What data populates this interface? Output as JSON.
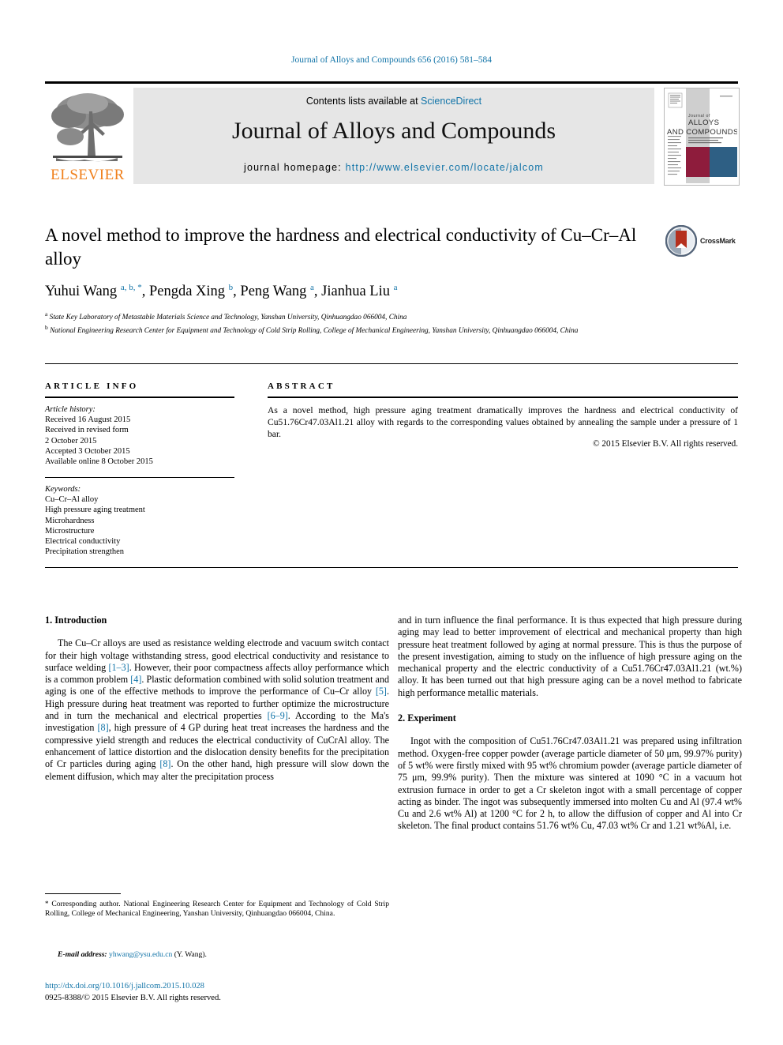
{
  "running_head": "Journal of Alloys and Compounds 656 (2016) 581–584",
  "masthead": {
    "contents_prefix": "Contents lists available at ",
    "sciencedirect": "ScienceDirect",
    "journal_title": "Journal of Alloys and Compounds",
    "homepage_prefix": "journal homepage: ",
    "homepage_url": "http://www.elsevier.com/locate/jalcom",
    "publisher": "ELSEVIER",
    "cover_title_line1": "Journal of",
    "cover_title_line2": "ALLOYS",
    "cover_title_line3": "AND COMPOUNDS"
  },
  "article": {
    "title": "A novel method to improve the hardness and electrical conductivity of Cu–Cr–Al alloy",
    "crossmark_label": "CrossMark",
    "authors_html": "Yuhui Wang <sup>a, b, *</sup>, Pengda Xing <sup>b</sup>, Peng Wang <sup>a</sup>, Jianhua Liu <sup>a</sup>",
    "affiliation_a": "State Key Laboratory of Metastable Materials Science and Technology, Yanshan University, Qinhuangdao 066004, China",
    "affiliation_b": "National Engineering Research Center for Equipment and Technology of Cold Strip Rolling, College of Mechanical Engineering, Yanshan University, Qinhuangdao 066004, China"
  },
  "info": {
    "heading": "ARTICLE INFO",
    "history_label": "Article history:",
    "history_lines": [
      "Received 16 August 2015",
      "Received in revised form",
      "2 October 2015",
      "Accepted 3 October 2015",
      "Available online 8 October 2015"
    ],
    "keywords_label": "Keywords:",
    "keywords": [
      "Cu–Cr–Al alloy",
      "High pressure aging treatment",
      "Microhardness",
      "Microstructure",
      "Electrical conductivity",
      "Precipitation strengthen"
    ]
  },
  "abstract": {
    "heading": "ABSTRACT",
    "text": "As a novel method, high pressure aging treatment dramatically improves the hardness and electrical conductivity of Cu51.76Cr47.03Al1.21 alloy with regards to the corresponding values obtained by annealing the sample under a pressure of 1 bar.",
    "copyright": "© 2015 Elsevier B.V. All rights reserved."
  },
  "body": {
    "section1_heading": "1. Introduction",
    "section1_para1_parts": [
      "The Cu–Cr alloys are used as resistance welding electrode and vacuum switch contact for their high voltage withstanding stress, good electrical conductivity and resistance to surface welding ",
      "[1–3]",
      ". However, their poor compactness affects alloy performance which is a common problem ",
      "[4]",
      ". Plastic deformation combined with solid solution treatment and aging is one of the effective methods to improve the performance of Cu–Cr alloy ",
      "[5]",
      ". High pressure during heat treatment was reported to further optimize the microstructure and in turn the mechanical and electrical properties ",
      "[6–9]",
      ". According to the Ma's investigation ",
      "[8]",
      ", high pressure of 4 GP during heat treat increases the hardness and the compressive yield strength and reduces the electrical conductivity of CuCrAl alloy. The enhancement of lattice distortion and the dislocation density benefits for the precipitation of Cr particles during aging ",
      "[8]",
      ". On the other hand, high pressure will slow down the element diffusion, which may alter the precipitation process"
    ],
    "section1_para1_cont": "and in turn influence the final performance. It is thus expected that high pressure during aging may lead to better improvement of electrical and mechanical property than high pressure heat treatment followed by aging at normal pressure. This is thus the purpose of the present investigation, aiming to study on the influence of high pressure aging on the mechanical property and the electric conductivity of a Cu51.76Cr47.03Al1.21 (wt.%) alloy. It has been turned out that high pressure aging can be a novel method to fabricate high performance metallic materials.",
    "section2_heading": "2. Experiment",
    "section2_para1": "Ingot with the composition of Cu51.76Cr47.03Al1.21 was prepared using infiltration method. Oxygen-free copper powder (average particle diameter of 50 μm, 99.97% purity) of 5 wt% were firstly mixed with 95 wt% chromium powder (average particle diameter of 75 μm, 99.9% purity). Then the mixture was sintered at 1090 °C in a vacuum hot extrusion furnace in order to get a Cr skeleton ingot with a small percentage of copper acting as binder. The ingot was subsequently immersed into molten Cu and Al (97.4 wt% Cu and 2.6 wt% Al) at 1200 °C for 2 h, to allow the diffusion of copper and Al into Cr skeleton. The final product contains 51.76 wt% Cu, 47.03 wt% Cr and 1.21 wt%Al, i.e."
  },
  "footer": {
    "corresponding_star": "*",
    "corresponding_text": " Corresponding author. National Engineering Research Center for Equipment and Technology of Cold Strip Rolling, College of Mechanical Engineering, Yanshan University, Qinhuangdao 066004, China.",
    "email_label": "E-mail address:",
    "email_address": "yhwang@ysu.edu.cn",
    "email_suffix": " (Y. Wang).",
    "doi": "http://dx.doi.org/10.1016/j.jallcom.2015.10.028",
    "issn": "0925-8388/© 2015 Elsevier B.V. All rights reserved."
  },
  "colors": {
    "link": "#1274a8",
    "elsevier_orange": "#f07f1a",
    "band_grey": "#e6e6e6"
  }
}
